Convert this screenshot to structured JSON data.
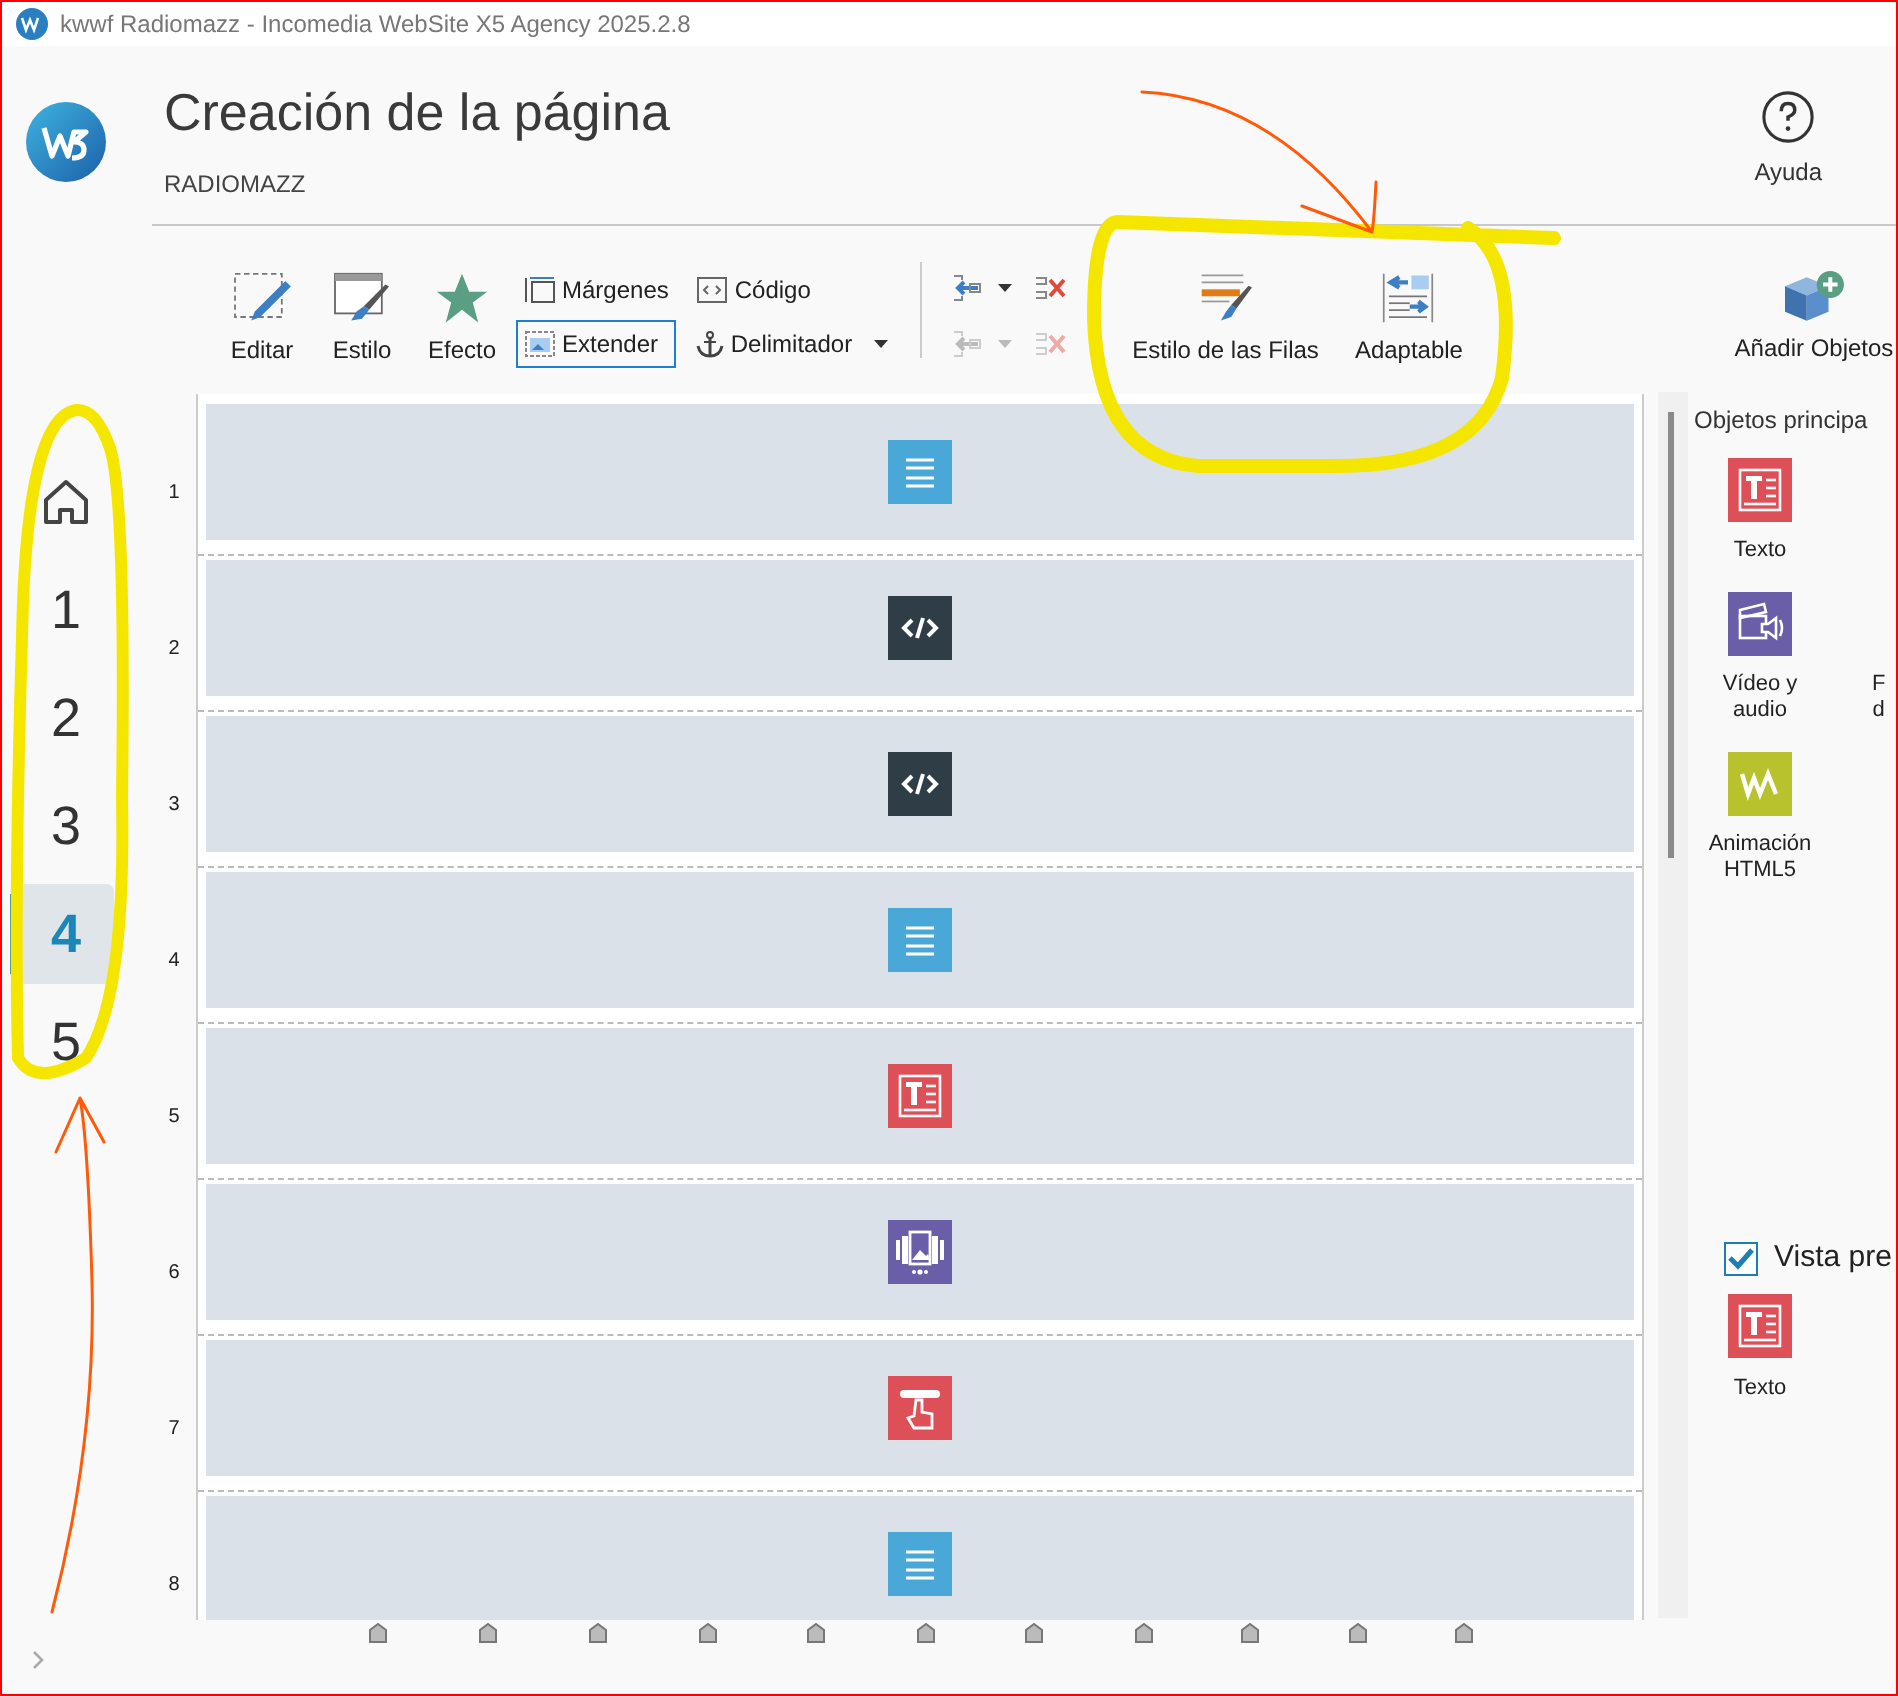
{
  "window": {
    "title": "kwwf Radiomazz - Incomedia WebSite X5 Agency 2025.2.8"
  },
  "header": {
    "title": "Creación de la página",
    "subtitle": "RADIOMAZZ",
    "help": "Ayuda"
  },
  "nav": [
    {
      "kind": "home",
      "selected": false
    },
    {
      "kind": "page",
      "label": "1",
      "selected": false
    },
    {
      "kind": "page",
      "label": "2",
      "selected": false
    },
    {
      "kind": "page",
      "label": "3",
      "selected": false
    },
    {
      "kind": "page",
      "label": "4",
      "selected": true
    },
    {
      "kind": "page",
      "label": "5",
      "selected": false
    }
  ],
  "toolbar": {
    "large": [
      {
        "kind": "edit",
        "label": "Editar"
      },
      {
        "kind": "style",
        "label": "Estilo"
      },
      {
        "kind": "effect",
        "label": "Efecto"
      }
    ],
    "small": [
      {
        "kind": "margins",
        "label": "Márgenes",
        "selected": false
      },
      {
        "kind": "code",
        "label": "Código",
        "selected": false
      },
      {
        "kind": "extend",
        "label": "Extender",
        "selected": true
      },
      {
        "kind": "anchor",
        "label": "Delimitador",
        "selected": false
      }
    ],
    "row_tools": [
      {
        "kind": "insert",
        "disabled": false
      },
      {
        "kind": "delete",
        "disabled": false
      },
      {
        "kind": "insert",
        "disabled": true
      },
      {
        "kind": "delete",
        "disabled": true
      }
    ],
    "row_style": [
      {
        "kind": "row-style",
        "label": "Estilo de las Filas"
      },
      {
        "kind": "responsive",
        "label": "Adaptable"
      }
    ]
  },
  "rows": [
    {
      "number": "1",
      "kind": "list"
    },
    {
      "number": "2",
      "kind": "code"
    },
    {
      "number": "3",
      "kind": "code"
    },
    {
      "number": "4",
      "kind": "list"
    },
    {
      "number": "5",
      "kind": "text"
    },
    {
      "number": "6",
      "kind": "gallery"
    },
    {
      "number": "7",
      "kind": "button"
    },
    {
      "number": "8",
      "kind": "list"
    }
  ],
  "objects_panel": {
    "add_button": "Añadir Objetos",
    "section": "Objetos principa",
    "rows": [
      [
        {
          "kind": "text",
          "lines": [
            "Texto"
          ]
        }
      ],
      [
        {
          "kind": "video",
          "lines": [
            "Vídeo y",
            "audio"
          ]
        },
        {
          "kind": "partial",
          "lines": [
            "F",
            "d"
          ]
        }
      ],
      [
        {
          "kind": "animation",
          "lines": [
            "Animación",
            "HTML5"
          ]
        }
      ]
    ]
  },
  "preview": {
    "checked": true,
    "label": "Vista pre",
    "item": {
      "kind": "text",
      "label": "Texto"
    }
  }
}
